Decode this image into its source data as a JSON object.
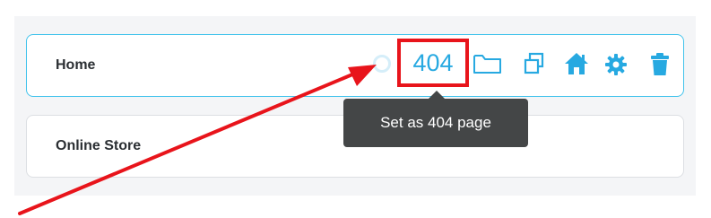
{
  "pages": [
    {
      "label": "Home"
    },
    {
      "label": "Online Store"
    }
  ],
  "home_actions": {
    "set_404_label": "404",
    "icons": [
      "spinner-icon",
      "folder-icon",
      "duplicate-icon",
      "home-icon",
      "gear-icon",
      "trash-icon"
    ]
  },
  "tooltip": {
    "text": "Set as 404 page"
  },
  "colors": {
    "accent": "#27a9e1",
    "selected_border": "#41c3ec",
    "highlight_red": "#e8141b",
    "tooltip_bg": "#444647",
    "annotation_arrow": "#e8141b"
  }
}
